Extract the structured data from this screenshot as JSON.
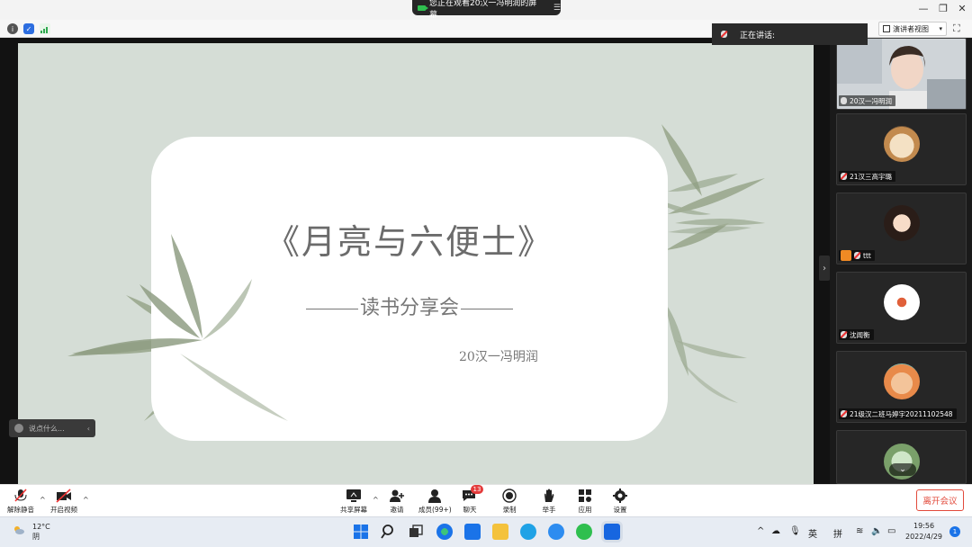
{
  "banner": {
    "text": "您正在观看20汉一冯明润的屏幕",
    "menu_icon": "menu-icon"
  },
  "window_controls": [
    "—",
    "❐",
    "✕"
  ],
  "top_toolbar": {
    "speaker_view_label": "演讲者视图",
    "talking_label": "正在讲话:"
  },
  "slide": {
    "title": "《月亮与六便士》",
    "subtitle": "读书分享会",
    "author": "20汉一冯明润"
  },
  "chat_placeholder": "说点什么...",
  "participants": [
    {
      "name": "20汉一冯明润",
      "muted": false
    },
    {
      "name": "21汉三高宇璐",
      "muted": true
    },
    {
      "name": "ttt",
      "muted": true,
      "host": true
    },
    {
      "name": "沈闻衡",
      "muted": true
    },
    {
      "name": "21级汉二班马婷宇20211102548",
      "muted": true
    },
    {
      "name": "",
      "muted": true
    }
  ],
  "bottom_toolbar": {
    "unmute": "解除静音",
    "start_video": "开启视频",
    "share_screen": "共享屏幕",
    "invite": "邀请",
    "members": "成员(99+)",
    "chat": "聊天",
    "chat_badge": "13",
    "record": "录制",
    "raise_hand": "举手",
    "apps": "应用",
    "settings": "设置",
    "leave": "离开会议"
  },
  "taskbar": {
    "temperature": "12°C",
    "weather": "阴",
    "ime_lang": "英",
    "ime_mode": "拼",
    "time": "19:56",
    "date": "2022/4/29",
    "notification_count": "1"
  },
  "colors": {
    "leave": "#e24a3b",
    "slide_bg": "#d5ddd6",
    "leaf": "#9aa88e"
  }
}
